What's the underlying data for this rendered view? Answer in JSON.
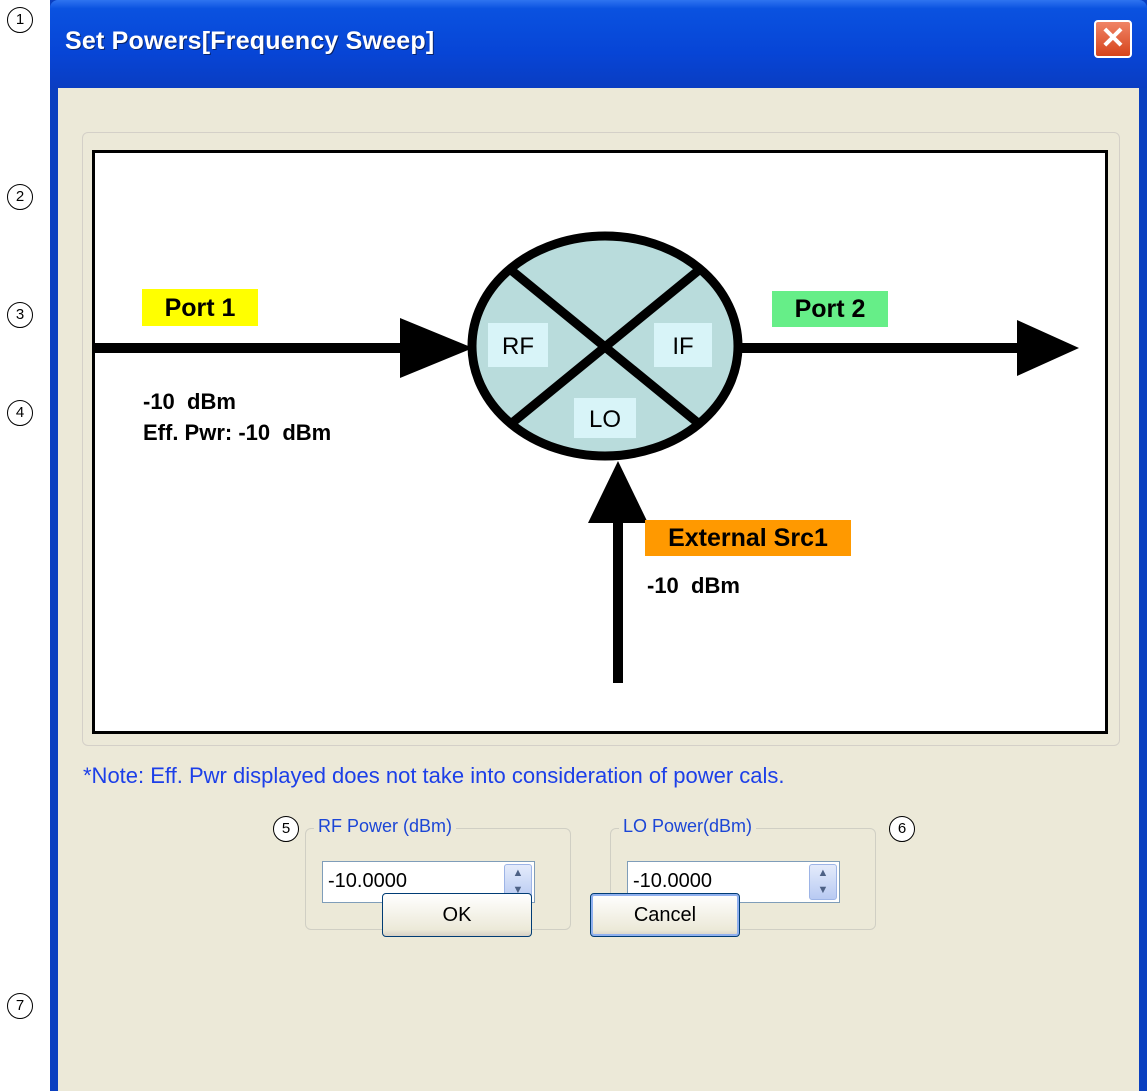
{
  "window": {
    "title": "Set Powers[Frequency Sweep]",
    "close_label": "✕"
  },
  "callouts": [
    "1",
    "2",
    "3",
    "4",
    "5",
    "6",
    "7"
  ],
  "diagram": {
    "port1_label": "Port 1",
    "port1_power": "-10  dBm",
    "port1_eff_power": "Eff. Pwr: -10  dBm",
    "port2_label": "Port 2",
    "mixer_rf": "RF",
    "mixer_if": "IF",
    "mixer_lo": "LO",
    "external_src_label": "External Src1",
    "external_src_power": "-10  dBm",
    "colors": {
      "port1_bg": "#ffff00",
      "port2_bg": "#66ee88",
      "external_bg": "#ff9900",
      "mixer_fill": "#b9dcdc",
      "mixer_label_bg": "#d8f4f8"
    }
  },
  "note": "*Note: Eff. Pwr displayed does not take into consideration of power cals.",
  "rf_power": {
    "legend": "RF Power (dBm)",
    "value": "-10.0000"
  },
  "lo_power": {
    "legend": "LO Power(dBm)",
    "value": "-10.0000"
  },
  "buttons": {
    "ok": "OK",
    "cancel": "Cancel"
  },
  "icons": {
    "spin_up": "▲",
    "spin_down": "▼"
  }
}
